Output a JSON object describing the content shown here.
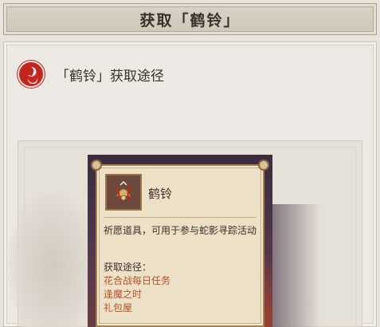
{
  "window": {
    "title": "获取「鹤铃」"
  },
  "section": {
    "label": "「鹤铃」获取途径",
    "icon": "tomoe-emblem-icon"
  },
  "item_card": {
    "name": "鹤铃",
    "icon": "crane-bell-icon",
    "description": "祈愿道具，可用于参与蛇影寻踪活动",
    "sources_title": "获取途径：",
    "sources": [
      "花合战每日任务",
      "逢魔之时",
      "礼包屋"
    ]
  },
  "colors": {
    "accent_red": "#c3261d",
    "source_text": "#b4532b",
    "card_bg": "#ece0c7"
  }
}
